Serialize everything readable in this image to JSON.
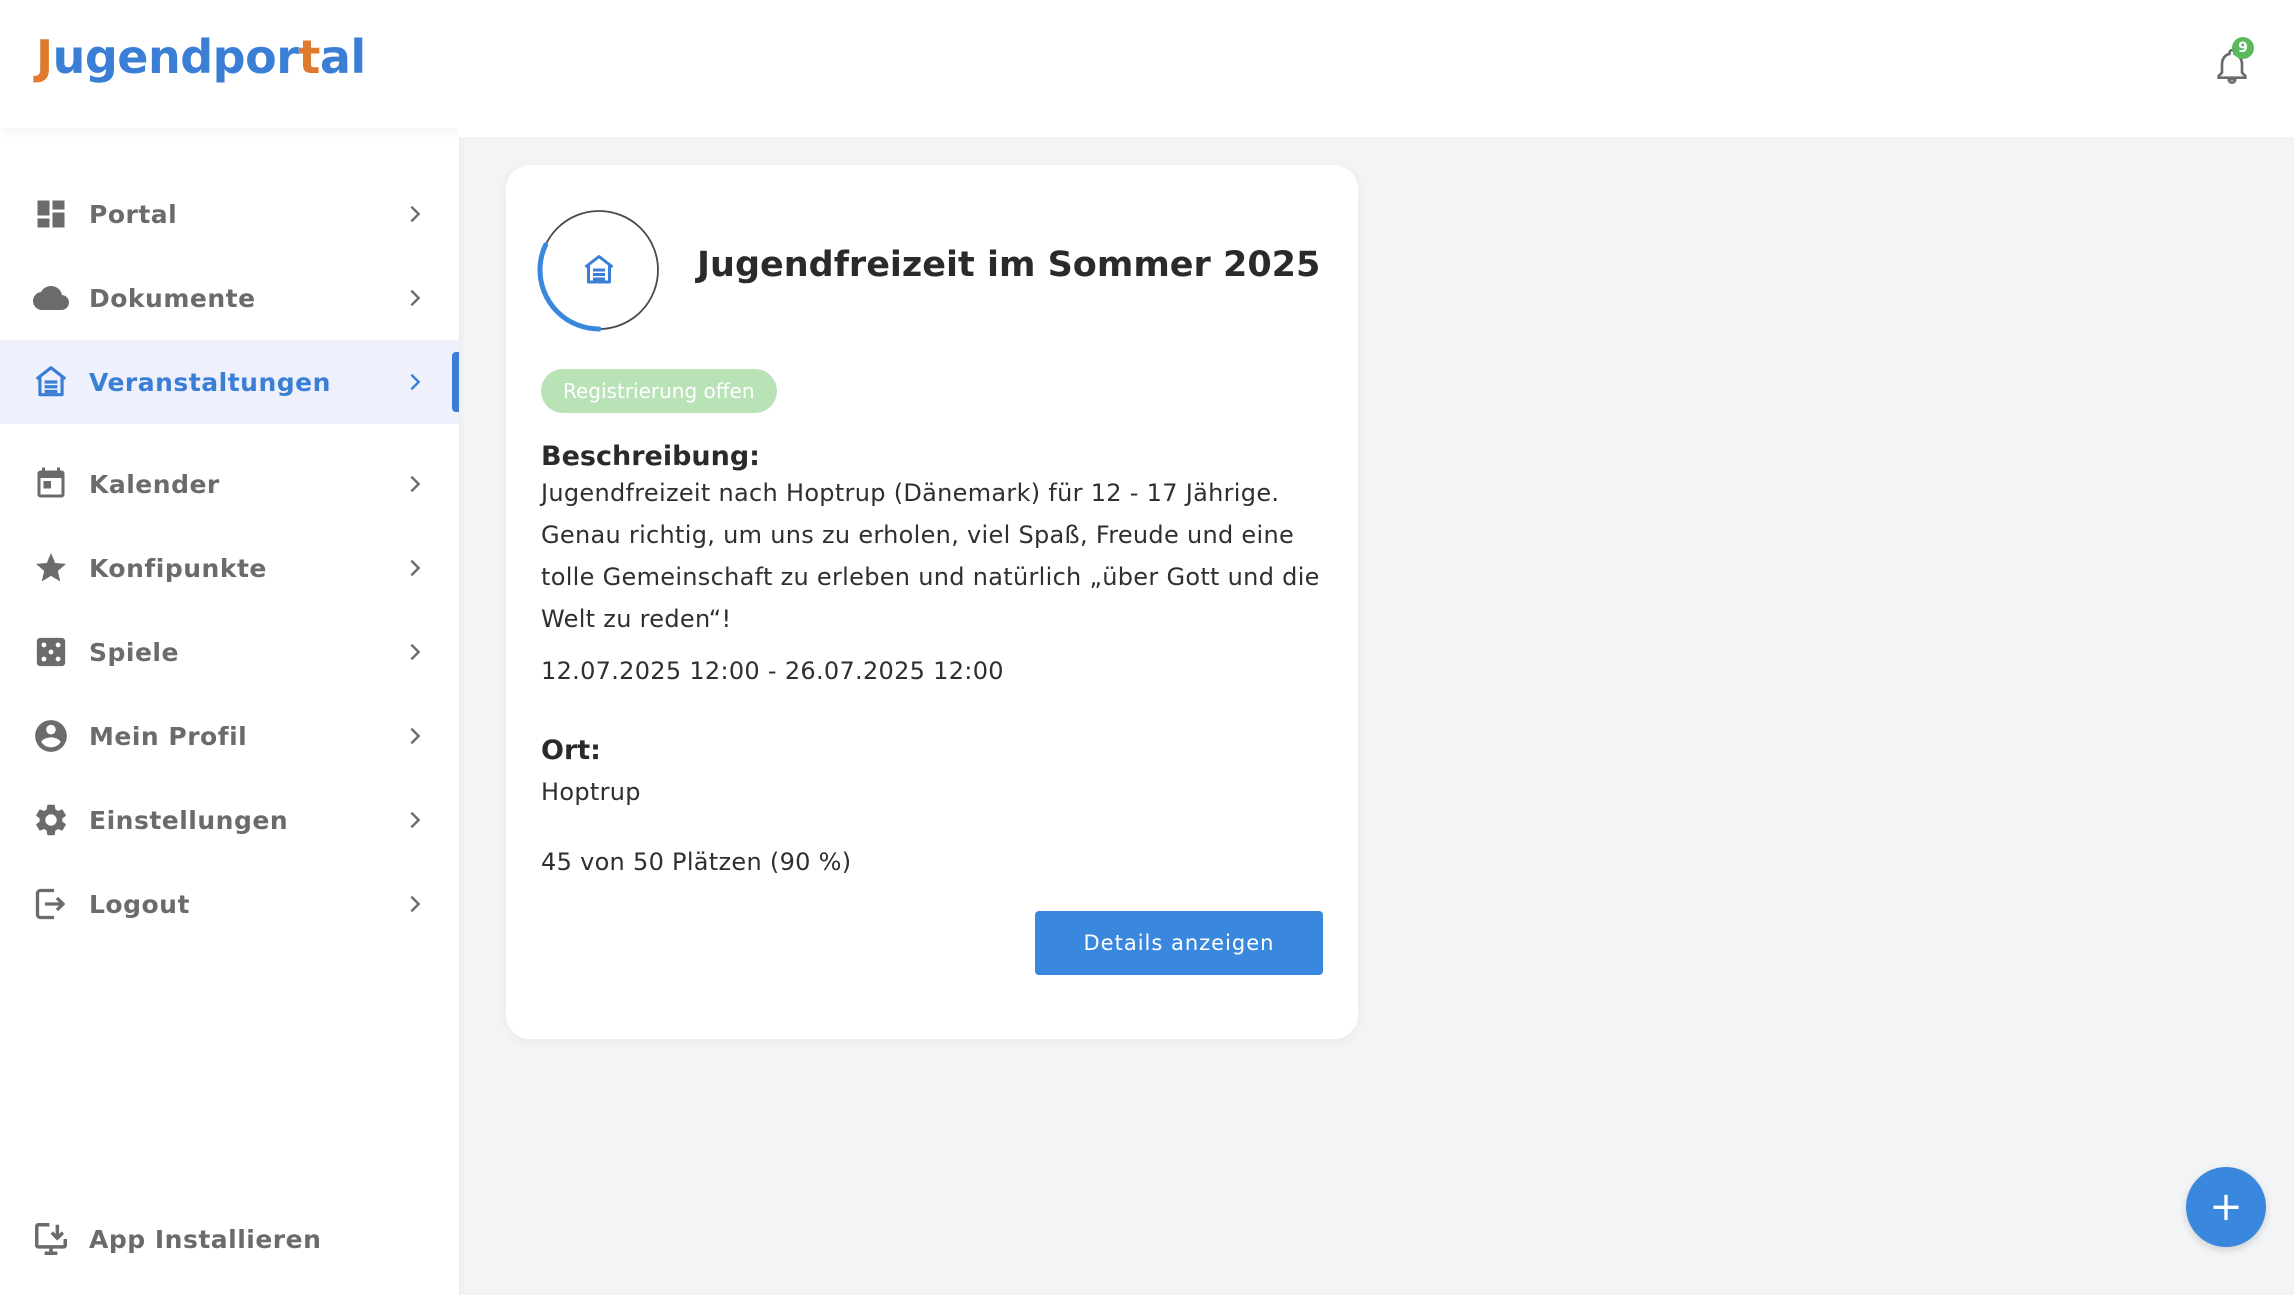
{
  "app": {
    "logo_part1": "Jugendpor",
    "logo_cross": "t",
    "logo_part2": "al"
  },
  "sidebar": {
    "items": [
      {
        "label": "Portal",
        "icon": "dashboard-icon"
      },
      {
        "label": "Dokumente",
        "icon": "cloud-icon"
      },
      {
        "label": "Veranstaltungen",
        "icon": "event-house-icon",
        "active": true
      },
      {
        "label": "Kalender",
        "icon": "calendar-icon"
      },
      {
        "label": "Konfipunkte",
        "icon": "star-icon"
      },
      {
        "label": "Spiele",
        "icon": "dice-icon"
      },
      {
        "label": "Mein Profil",
        "icon": "account-circle-icon"
      },
      {
        "label": "Einstellungen",
        "icon": "gear-icon"
      },
      {
        "label": "Logout",
        "icon": "logout-icon"
      }
    ],
    "install_label": "App Installieren"
  },
  "header": {
    "notification_count": "9"
  },
  "event": {
    "title": "Jugendfreizeit im Sommer 2025",
    "status": "Registrierung offen",
    "description_heading": "Beschreibung:",
    "description": "Jugendfreizeit nach Hoptrup (Dänemark) für 12 - 17 Jährige. Genau richtig, um uns zu erholen, viel Spaß, Freude und eine tolle Gemeinschaft zu erleben und natürlich „über Gott und die Welt zu reden“!",
    "date_range": "12.07.2025 12:00 - 26.07.2025 12:00",
    "location_heading": "Ort:",
    "location": "Hoptrup",
    "capacity": "45 von 50 Plätzen (90 %)",
    "capacity_fraction": 0.9,
    "details_button": "Details anzeigen"
  },
  "fab": {
    "label": "+"
  },
  "colors": {
    "accent": "#3a87de",
    "brand_orange": "#e07a2e",
    "status_green": "#b9e2b7",
    "badge_green": "#5cb85c"
  }
}
